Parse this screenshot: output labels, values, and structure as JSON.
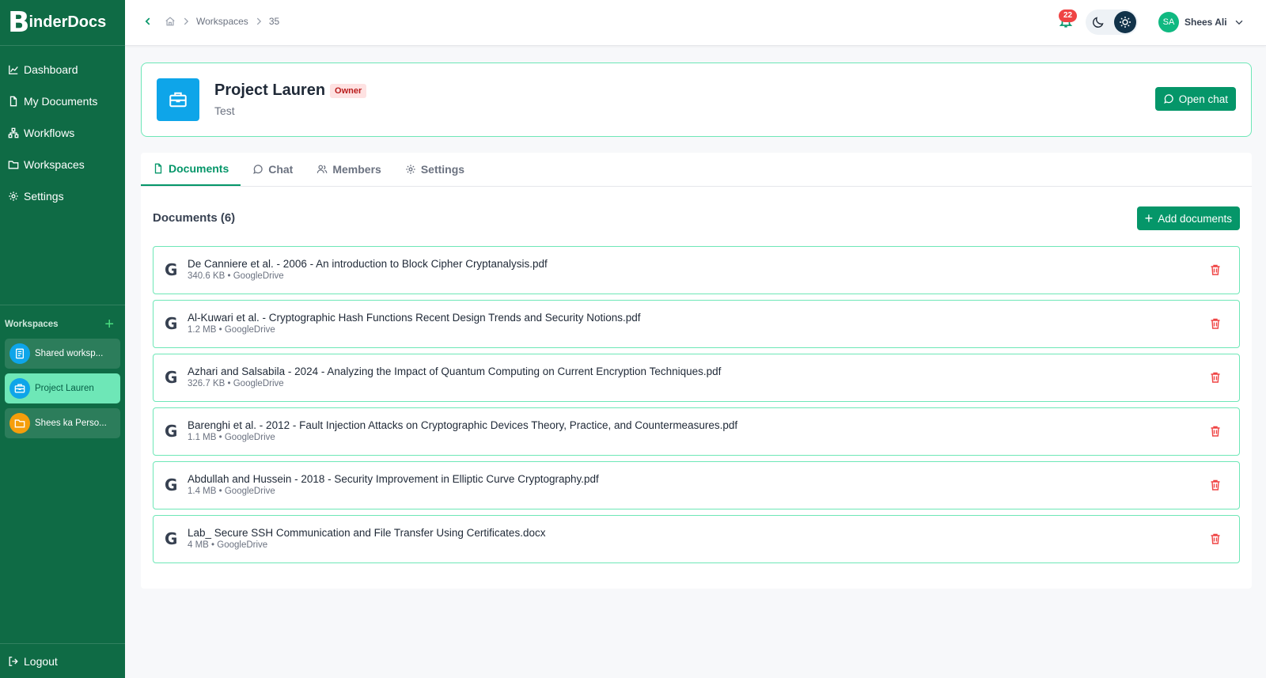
{
  "app": {
    "logo_letter": "B",
    "logo_text": "inderDocs"
  },
  "sidebar": {
    "nav": [
      {
        "label": "Dashboard",
        "icon": "chart-line-icon"
      },
      {
        "label": "My Documents",
        "icon": "file-icon"
      },
      {
        "label": "Workflows",
        "icon": "workflow-icon"
      },
      {
        "label": "Workspaces",
        "icon": "folder-icon"
      },
      {
        "label": "Settings",
        "icon": "gear-icon"
      }
    ],
    "workspaces_title": "Workspaces",
    "add_symbol": "+",
    "workspaces": [
      {
        "label": "Shared worksp...",
        "icon": "document-icon",
        "color": "#0ea5e9"
      },
      {
        "label": "Project Lauren",
        "icon": "briefcase-icon",
        "color": "#0ea5e9",
        "active": true
      },
      {
        "label": "Shees ka Perso...",
        "icon": "folder-icon",
        "color": "#f59e0b"
      }
    ],
    "logout": "Logout"
  },
  "topbar": {
    "breadcrumbs": [
      "Workspaces",
      "35"
    ],
    "notification_count": "22",
    "user_initials": "SA",
    "user_name": "Shees Ali"
  },
  "project": {
    "name": "Project Lauren",
    "role": "Owner",
    "description": "Test",
    "open_chat_label": "Open chat"
  },
  "tabs": [
    {
      "label": "Documents",
      "icon": "file-icon",
      "active": true
    },
    {
      "label": "Chat",
      "icon": "chat-icon"
    },
    {
      "label": "Members",
      "icon": "users-icon"
    },
    {
      "label": "Settings",
      "icon": "gear-icon"
    }
  ],
  "documents": {
    "heading": "Documents (6)",
    "add_label": "Add documents",
    "add_symbol": "+",
    "source_glyph": "G",
    "items": [
      {
        "name": "De Canniere et al. - 2006 - An introduction to Block Cipher Cryptanalysis.pdf",
        "meta": "340.6 KB • GoogleDrive"
      },
      {
        "name": "Al-Kuwari et al. - Cryptographic Hash Functions Recent Design Trends and Security Notions.pdf",
        "meta": "1.2 MB • GoogleDrive"
      },
      {
        "name": "Azhari and Salsabila - 2024 - Analyzing the Impact of Quantum Computing on Current Encryption Techniques.pdf",
        "meta": "326.7 KB • GoogleDrive"
      },
      {
        "name": "Barenghi et al. - 2012 - Fault Injection Attacks on Cryptographic Devices Theory, Practice, and Countermeasures.pdf",
        "meta": "1.1 MB • GoogleDrive"
      },
      {
        "name": "Abdullah and Hussein - 2018 - Security Improvement in Elliptic Curve Cryptography.pdf",
        "meta": "1.4 MB • GoogleDrive"
      },
      {
        "name": "Lab_ Secure SSH Communication and File Transfer Using Certificates.docx",
        "meta": "4 MB • GoogleDrive"
      }
    ]
  },
  "colors": {
    "sidebar": "#0f6b45",
    "accent": "#059669",
    "accent_light": "#6ee7b7",
    "danger": "#ef4444"
  }
}
